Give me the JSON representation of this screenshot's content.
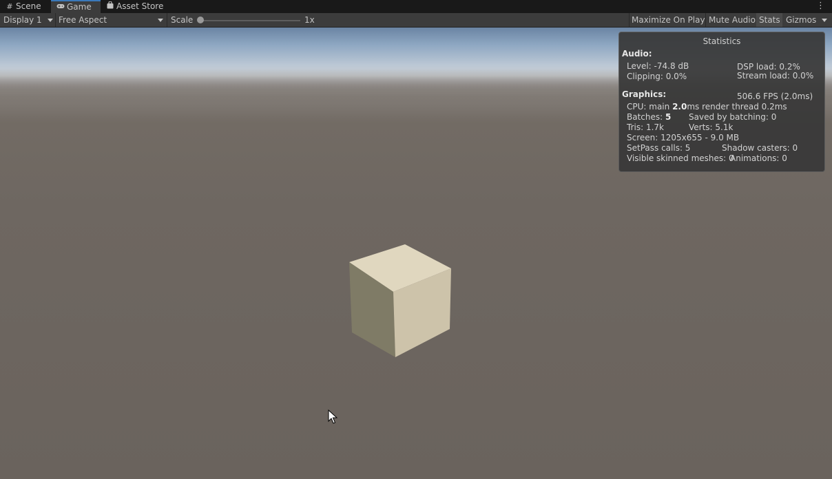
{
  "tabs": [
    {
      "label": "Scene",
      "icon": "grid-icon"
    },
    {
      "label": "Game",
      "icon": "gamepad-icon"
    },
    {
      "label": "Asset Store",
      "icon": "bag-icon"
    }
  ],
  "toolbar": {
    "display": "Display 1",
    "aspect": "Free Aspect",
    "scale_label": "Scale",
    "scale_value": "1x",
    "scale_fraction": 0.0,
    "maximize": "Maximize On Play",
    "mute": "Mute Audio",
    "stats": "Stats",
    "gizmos": "Gizmos"
  },
  "stats": {
    "title": "Statistics",
    "audio_header": "Audio:",
    "level": "Level: -74.8 dB",
    "clipping": "Clipping: 0.0%",
    "dsp_load": "DSP load: 0.2%",
    "stream_load": "Stream load: 0.0%",
    "graphics_header": "Graphics:",
    "fps": "506.6 FPS (2.0ms)",
    "cpu_prefix": "CPU: main ",
    "cpu_main": "2.0",
    "cpu_suffix": "ms  render thread 0.2ms",
    "batches_prefix": "Batches: ",
    "batches": "5",
    "saved_batching": "Saved by batching: 0",
    "tris": "Tris: 1.7k",
    "verts": "Verts: 5.1k",
    "screen": "Screen: 1205x655 - 9.0 MB",
    "setpass": "SetPass calls: 5",
    "shadow_casters": "Shadow casters: 0",
    "skinned_meshes": "Visible skinned meshes: 0",
    "animations": "Animations: 0"
  },
  "colors": {
    "active_tab_accent": "#3a79bb",
    "cube_top": "#e0d7bf",
    "cube_right": "#cdc3aa",
    "cube_left": "#7f7b66"
  }
}
